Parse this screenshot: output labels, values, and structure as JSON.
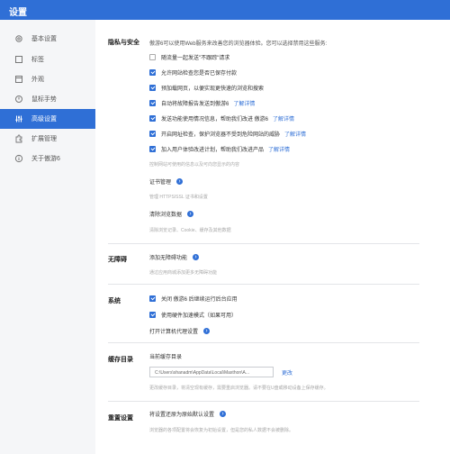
{
  "window": {
    "title": "设置"
  },
  "sidebar": {
    "items": [
      {
        "label": "基本设置",
        "icon": "gear-icon"
      },
      {
        "label": "标签",
        "icon": "tab-icon"
      },
      {
        "label": "外观",
        "icon": "appearance-icon"
      },
      {
        "label": "鼠标手势",
        "icon": "mouse-gesture-icon"
      },
      {
        "label": "高级设置",
        "icon": "advanced-sliders-icon",
        "active": true
      },
      {
        "label": "扩展管理",
        "icon": "puzzle-icon"
      },
      {
        "label": "关于傲游6",
        "icon": "info-icon"
      }
    ]
  },
  "privacy": {
    "title": "隐私与安全",
    "intro": "傲游6可以使用Web服务来改善您的浏览器体验。您可以选择禁用这些服务:",
    "options": [
      {
        "label": "随流量一起发送\"不跟踪\"请求",
        "checked": false
      },
      {
        "label": "允许网站检查您是否已保存付款",
        "checked": true
      },
      {
        "label": "预加载网页，以便实现更快速的浏览和搜索",
        "checked": true
      },
      {
        "label": "自动将故障报告发送到傲游6",
        "checked": true,
        "link": "了解详情"
      },
      {
        "label": "发送功能使用情况信息，帮助我们改进 傲游6",
        "checked": true,
        "link": "了解详情"
      },
      {
        "label": "开启网址检查，保护浏览器不受到危险网站的威胁",
        "checked": true,
        "link": "了解详情"
      },
      {
        "label": "加入用户体验改进计划，帮助我们改进产品",
        "checked": true,
        "link": "了解详情"
      }
    ],
    "hint_content": "控制网站可使用的信息以及可向您显示的内容",
    "cert_label": "证书管理",
    "cert_hint": "管理 HTTPS/SSL 证书和设置",
    "clear_label": "清除浏览数据",
    "clear_hint": "清除浏览记录、Cookie、缓存及其他数据"
  },
  "accessibility": {
    "title": "无障碍",
    "add_label": "添加无障碍功能",
    "add_hint": "通过应用商城添加更多无障碍功能"
  },
  "system": {
    "title": "系统",
    "options": [
      {
        "label": "关闭 傲游6 后继续运行后台应用",
        "checked": true
      },
      {
        "label": "使用硬件加速模式（如果可用）",
        "checked": true
      }
    ],
    "proxy_label": "打开计算机代理设置"
  },
  "cache": {
    "title": "缓存目录",
    "current_label": "当前缓存目录",
    "path": "C:\\Users\\shanadm\\AppData\\Local\\Maxthon\\A...",
    "change_label": "更改",
    "hint": "更改缓存目录，将清空现有缓存，需要重启浏览器。请不要在U盘或移动设备上保存缓存。"
  },
  "reset": {
    "title": "重置设置",
    "label": "将设置还原为原始默认设置",
    "hint": "浏览器的各项配置将会恢复为初始设置，但是您的私人数据不会被删除。"
  },
  "colors": {
    "accent": "#2f6fd6",
    "sidebar_bg": "#f5f6f8"
  }
}
